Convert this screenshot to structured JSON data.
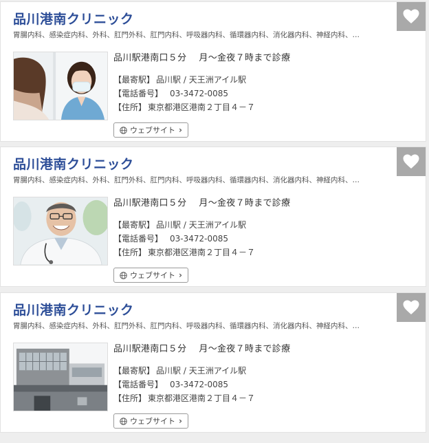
{
  "clinics": [
    {
      "name": "品川港南クリニック",
      "departments": "胃腸内科、感染症内科、外科、肛門外科、肛門内科、呼吸器内科、循環器内科、消化器内科、神経内科、…",
      "access": "品川駅港南口５分",
      "hours": "月～金夜７時まで診療",
      "station_label": "【最寄駅】",
      "station": "品川駅 / 天王洲アイル駅",
      "tel_label": "【電話番号】",
      "tel": "03-3472-0085",
      "address_label": "【住所】",
      "address": "東京都港区港南２丁目４－７",
      "website_label": "ウェブサイト"
    },
    {
      "name": "品川港南クリニック",
      "departments": "胃腸内科、感染症内科、外科、肛門外科、肛門内科、呼吸器内科、循環器内科、消化器内科、神経内科、…",
      "access": "品川駅港南口５分",
      "hours": "月～金夜７時まで診療",
      "station_label": "【最寄駅】",
      "station": "品川駅 / 天王洲アイル駅",
      "tel_label": "【電話番号】",
      "tel": "03-3472-0085",
      "address_label": "【住所】",
      "address": "東京都港区港南２丁目４－７",
      "website_label": "ウェブサイト"
    },
    {
      "name": "品川港南クリニック",
      "departments": "胃腸内科、感染症内科、外科、肛門外科、肛門内科、呼吸器内科、循環器内科、消化器内科、神経内科、…",
      "access": "品川駅港南口５分",
      "hours": "月～金夜７時まで診療",
      "station_label": "【最寄駅】",
      "station": "品川駅 / 天王洲アイル駅",
      "tel_label": "【電話番号】",
      "tel": "03-3472-0085",
      "address_label": "【住所】",
      "address": "東京都港区港南２丁目４－７",
      "website_label": "ウェブサイト"
    }
  ],
  "icons": {
    "favorite": "heart-icon",
    "website": "globe-icon",
    "chevron": "chevron-right-icon"
  },
  "colors": {
    "clinic_name": "#2d4e98",
    "favorite_bg": "#a9a9a9"
  }
}
